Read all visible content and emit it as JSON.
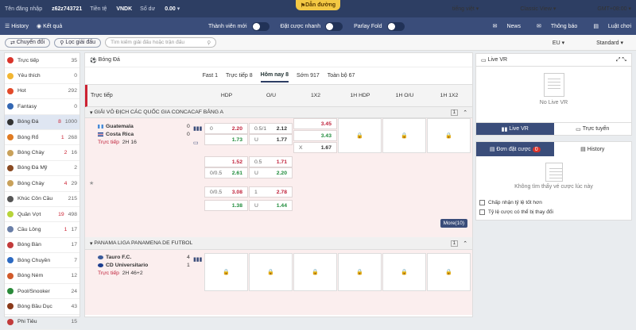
{
  "topbar": {
    "login_label": "Tên đăng nhập",
    "username": "z62z743721",
    "currency_label": "Tiền tệ",
    "currency": "VNDK",
    "balance_label": "Số dư",
    "balance": "0.00",
    "guide": "Dẫn đường",
    "language": "tiếng việt",
    "view": "Classic View",
    "timezone": "GMT+08:00"
  },
  "navbar": {
    "history": "History",
    "results": "Kết quả",
    "member_new": "Thành viên mới",
    "fast_bet": "Đặt cược nhanh",
    "parlay_fold": "Parlay Fold",
    "news": "News",
    "notice": "Thông báo",
    "rules": "Luật chơi"
  },
  "filterbar": {
    "switch": "Chuyển đổi",
    "filter": "Lọc giải đấu",
    "search_placeholder": "Tìm kiếm giải đấu hoặc trận đấu",
    "odds": "EU",
    "mode": "Standard"
  },
  "sidebar": [
    {
      "label": "Trực tiếp",
      "live": "",
      "count": "35",
      "color": "#d9342b"
    },
    {
      "label": "Yêu thích",
      "live": "",
      "count": "0",
      "color": "#f2b632"
    },
    {
      "label": "Hot",
      "live": "",
      "count": "292",
      "color": "#e24a2a"
    },
    {
      "label": "Fantasy",
      "live": "",
      "count": "0",
      "color": "#3367b3"
    },
    {
      "label": "Bóng Đá",
      "live": "8",
      "count": "1000",
      "color": "#333"
    },
    {
      "label": "Bóng Rổ",
      "live": "1",
      "count": "268",
      "color": "#e07b22"
    },
    {
      "label": "Bóng Chày",
      "live": "2",
      "count": "16",
      "color": "#c9a15a"
    },
    {
      "label": "Bóng Đá Mỹ",
      "live": "",
      "count": "2",
      "color": "#8a4a22"
    },
    {
      "label": "Bóng Chày",
      "live": "4",
      "count": "29",
      "color": "#c9a15a"
    },
    {
      "label": "Khúc Côn Cầu",
      "live": "",
      "count": "215",
      "color": "#555"
    },
    {
      "label": "Quần Vợt",
      "live": "19",
      "count": "498",
      "color": "#b7d43a"
    },
    {
      "label": "Cầu Lông",
      "live": "1",
      "count": "17",
      "color": "#6a7fa8"
    },
    {
      "label": "Bóng Bàn",
      "live": "",
      "count": "17",
      "color": "#c23b3b"
    },
    {
      "label": "Bóng Chuyền",
      "live": "",
      "count": "7",
      "color": "#2d6ac2"
    },
    {
      "label": "Bóng Ném",
      "live": "",
      "count": "12",
      "color": "#d15a2a"
    },
    {
      "label": "Pool/Snooker",
      "live": "",
      "count": "24",
      "color": "#2a8a3a"
    },
    {
      "label": "Bóng Bầu Dục",
      "live": "",
      "count": "43",
      "color": "#8a3a1a"
    },
    {
      "label": "Phi Tiêu",
      "live": "",
      "count": "15",
      "color": "#c23b3b"
    }
  ],
  "main": {
    "sport_title": "Bóng Đá",
    "tabs": [
      "Fast 1",
      "Trực tiếp 8",
      "Hôm nay 8",
      "Sớm 917",
      "Toàn bộ 67"
    ],
    "col_live": "Trực tiếp",
    "cols": [
      "HDP",
      "O/U",
      "1X2",
      "1H HDP",
      "1H O/U",
      "1H 1X2"
    ],
    "league1": {
      "name": "GIẢI VÔ ĐỊCH CÁC QUỐC GIA CONCACAF BẢNG A",
      "badge": "1"
    },
    "match1": {
      "home": "Guatemala",
      "away": "Costa Rica",
      "home_score": "0",
      "away_score": "0",
      "live": "Trực tiếp",
      "time": "2H 16"
    },
    "row1": {
      "hdp_h": "0",
      "hdp_ho": "2.20",
      "hdp_a": "",
      "hdp_ao": "1.73",
      "ou_h": "0.5/1",
      "ou_ho": "2.12",
      "ou_a": "U",
      "ou_ao": "1.77",
      "x1": "3.45",
      "x2": "3.43",
      "xx": "X",
      "xxo": "1.67"
    },
    "row2": {
      "hdp_ho": "1.52",
      "hdp_a": "0/0.5",
      "hdp_ao": "2.61",
      "ou_h": "0.5",
      "ou_ho": "1.71",
      "ou_a": "U",
      "ou_ao": "2.20"
    },
    "row3": {
      "hdp_h": "0/0.5",
      "hdp_ho": "3.08",
      "hdp_ao": "1.38",
      "ou_h": "1",
      "ou_ho": "2.78",
      "ou_a": "U",
      "ou_ao": "1.44"
    },
    "more1": "More(10)",
    "league2": {
      "name": "PANAMA LIGA PANAMENA DE FUTBOL",
      "badge": "1"
    },
    "match2": {
      "home": "Tauro F.C.",
      "away": "CD Universitario",
      "home_score": "4",
      "away_score": "1",
      "live": "Trực tiếp",
      "time": "2H 46+2"
    }
  },
  "right": {
    "live_vr": "Live VR",
    "no_live_vr": "No Live VR",
    "tab_vr": "Live VR",
    "tab_stream": "Trực tuyến",
    "bets": "Đơn đặt cược",
    "bets_count": "0",
    "history": "History",
    "no_bets": "Không tìm thấy vé cược lúc này",
    "accept": "Chấp nhận tỷ lệ tốt hơn",
    "odds_change": "Tỷ lệ cược có thể bị thay đổi"
  }
}
